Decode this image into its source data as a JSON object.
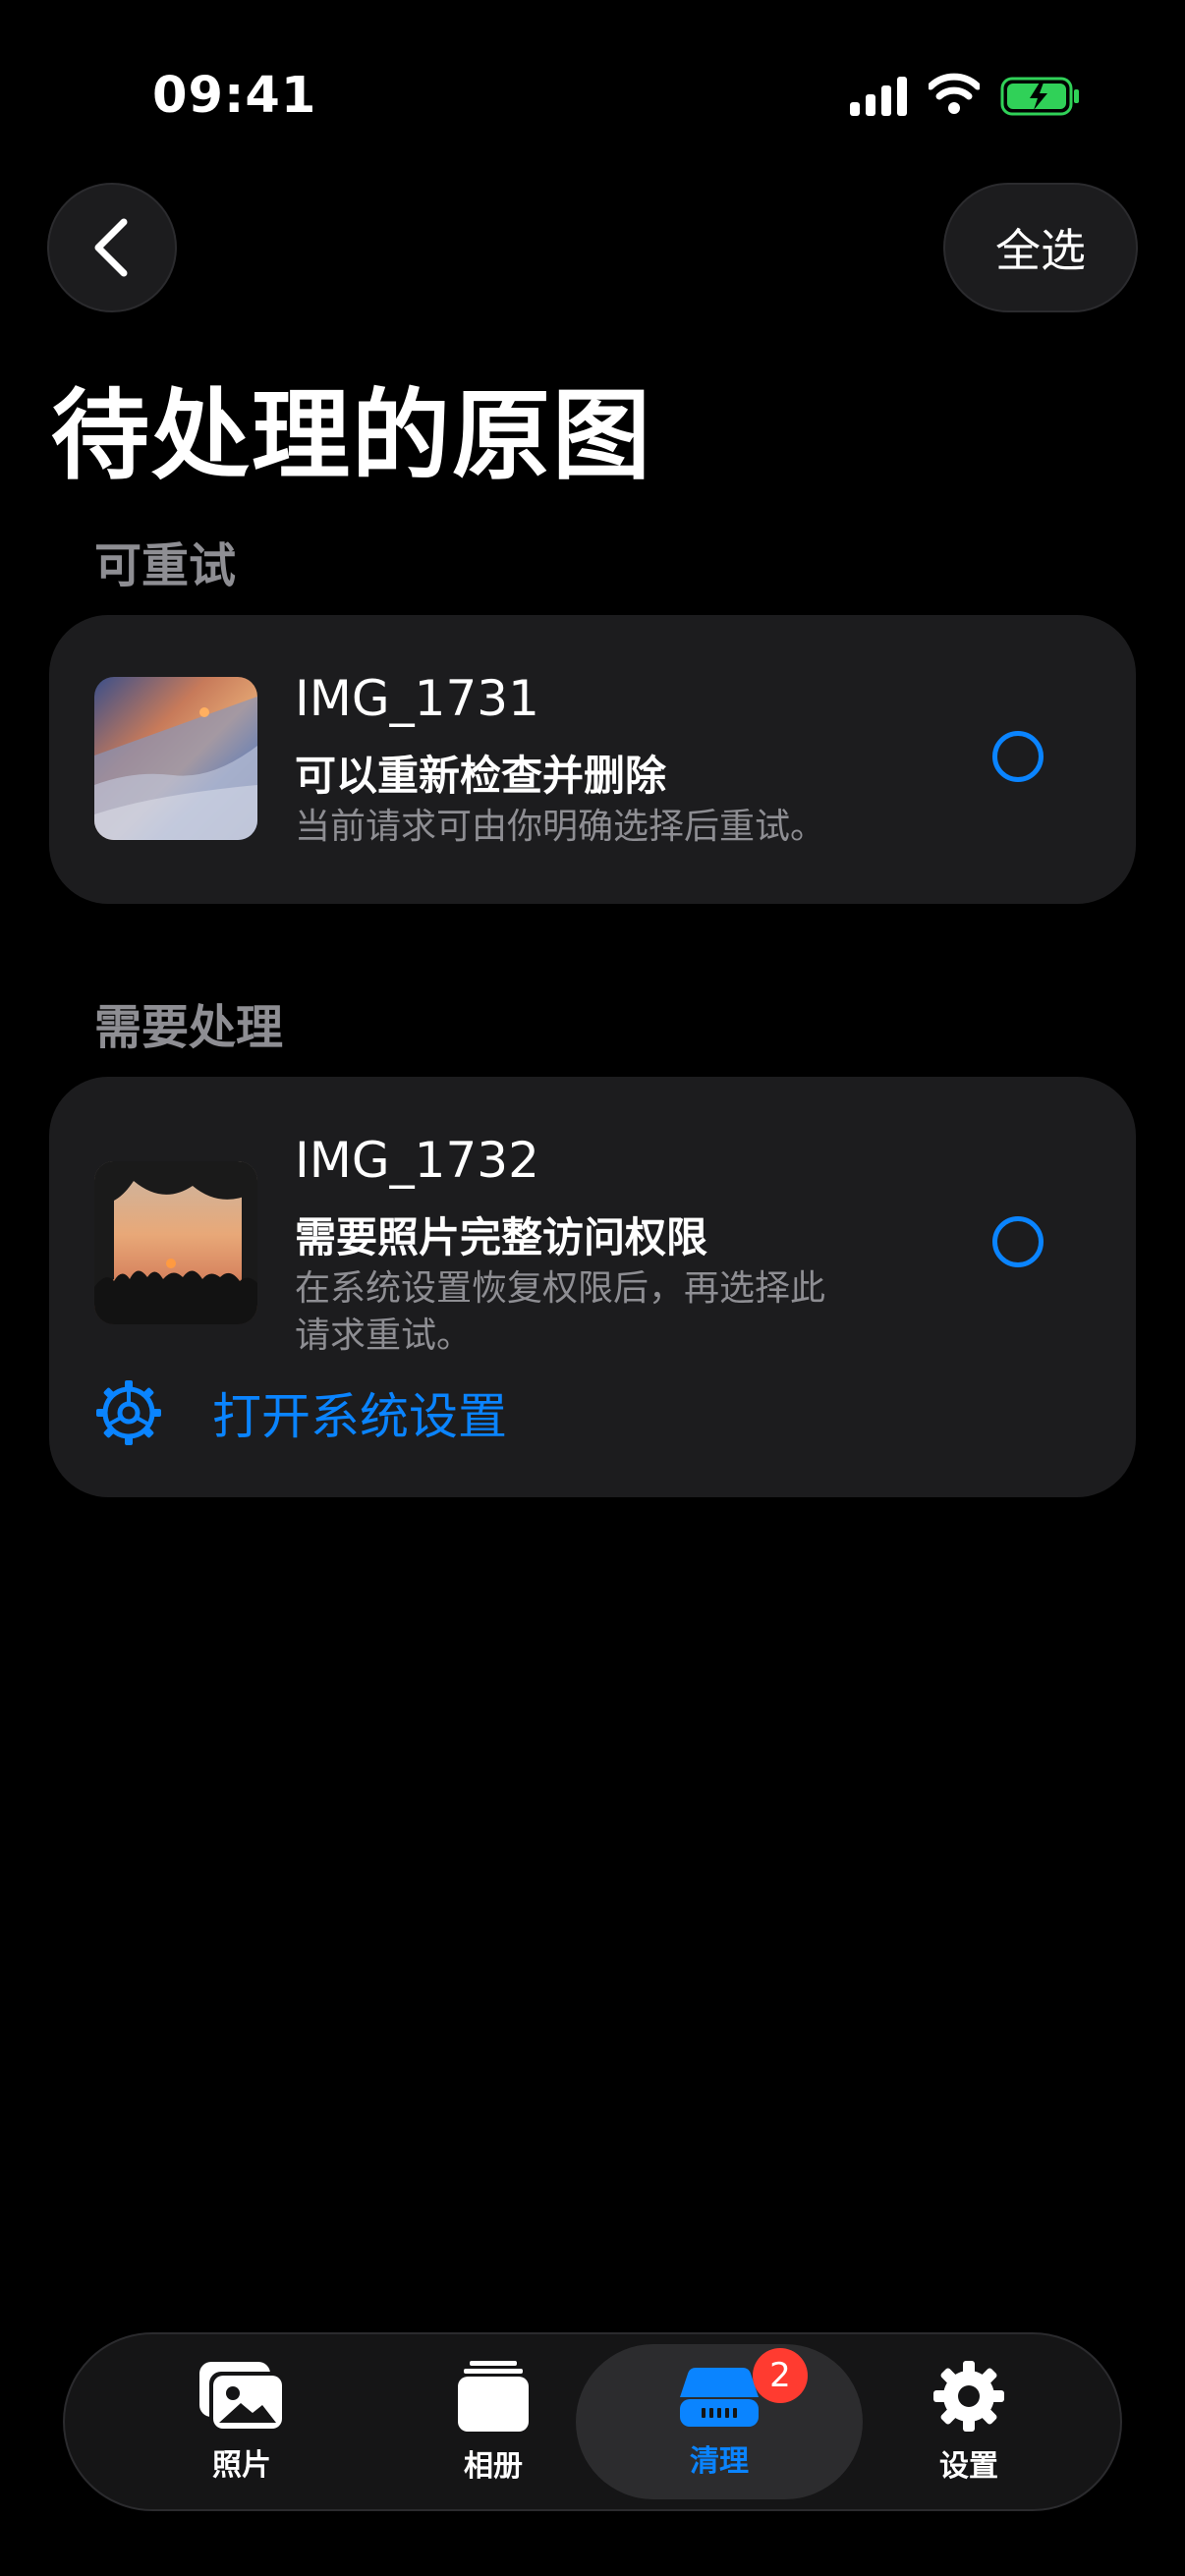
{
  "status_bar": {
    "time": "09:41"
  },
  "header": {
    "back_icon": "chevron-left-icon",
    "select_all_label": "全选"
  },
  "page": {
    "title": "待处理的原图"
  },
  "sections": [
    {
      "label": "可重试",
      "items": [
        {
          "name": "IMG_1731",
          "status": "可以重新检查并删除",
          "desc_lines": [
            "当前请求可由你明确选择后重试。"
          ],
          "thumbnail": "sky-clouds-sunset-photo",
          "selected": false
        }
      ]
    },
    {
      "label": "需要处理",
      "items": [
        {
          "name": "IMG_1732",
          "status": "需要照片完整访问权限",
          "desc_lines": [
            "在系统设置恢复权限后，再选择此",
            "请求重试。"
          ],
          "thumbnail": "people-silhouette-sunset-photo",
          "selected": false,
          "link_label": "打开系统设置",
          "link_icon": "gear-icon"
        }
      ]
    }
  ],
  "tabbar": {
    "tabs": [
      {
        "label": "照片",
        "icon": "photos-icon",
        "active": false
      },
      {
        "label": "相册",
        "icon": "albums-icon",
        "active": false
      },
      {
        "label": "清理",
        "icon": "storage-clean-icon",
        "active": true,
        "badge": "2"
      },
      {
        "label": "设置",
        "icon": "gear-icon",
        "active": false
      }
    ]
  },
  "colors": {
    "accent": "#0a84ff",
    "badge": "#ff3b30",
    "card": "#1c1c1e",
    "battery": "#30d158"
  }
}
